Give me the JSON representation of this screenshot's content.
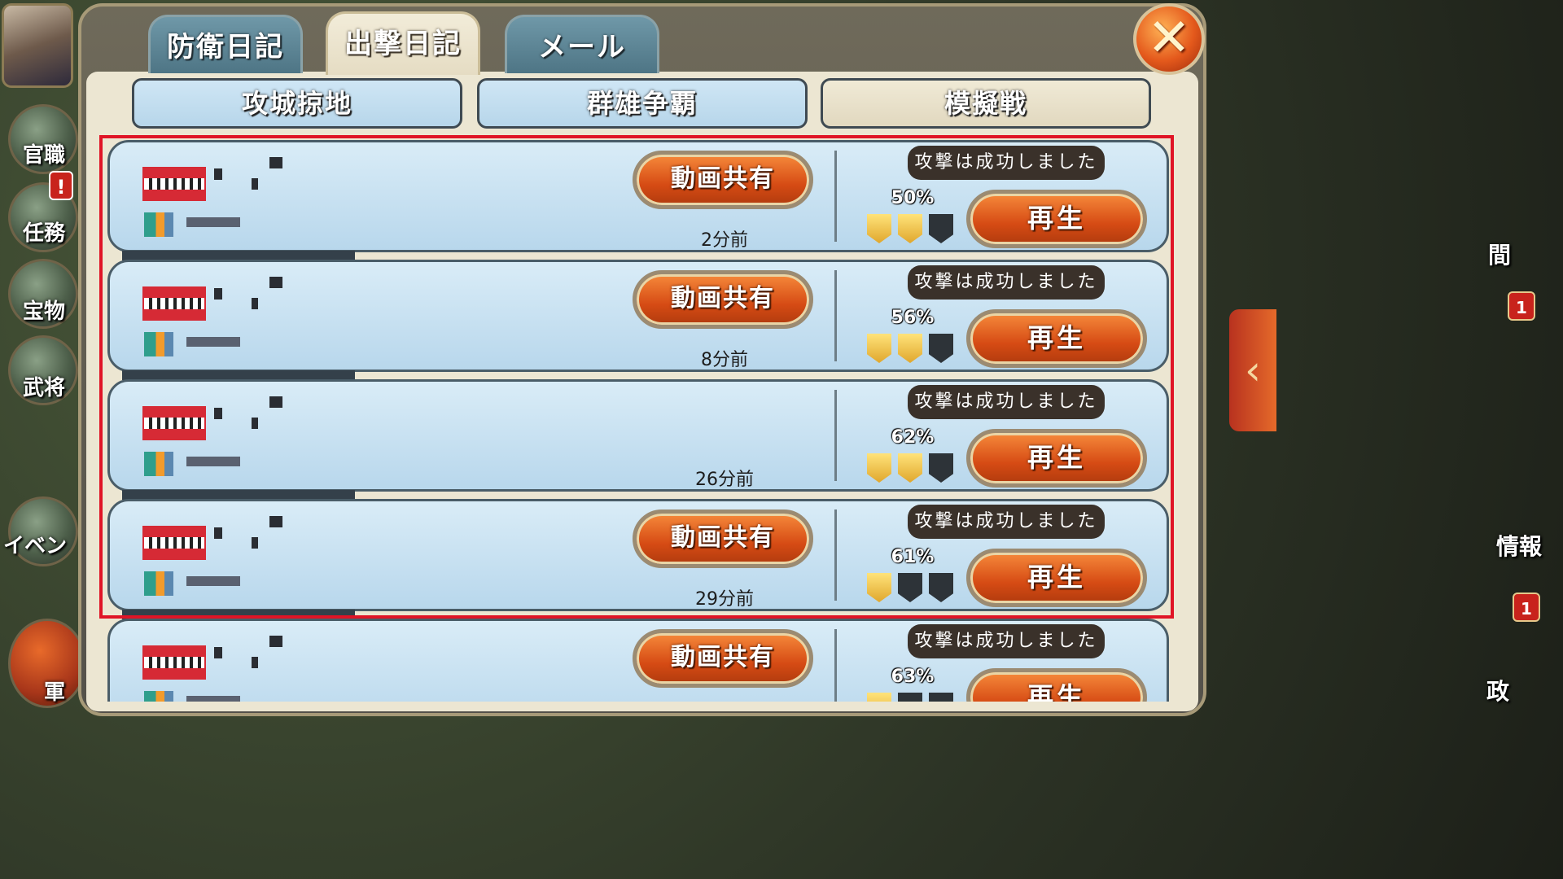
{
  "tabs": {
    "defense": "防衛日記",
    "attack": "出撃日記",
    "mail": "メール"
  },
  "subtabs": {
    "siege": "攻城掠地",
    "heroes": "群雄争覇",
    "mock": "模擬戦"
  },
  "close_icon": "close-x-icon",
  "left_menu": {
    "officials": "官職",
    "tasks": "任務",
    "treasure": "宝物",
    "generals": "武将",
    "event": "イベン",
    "army": "軍"
  },
  "right_menu": {
    "time_frag": "間",
    "intel": "情報",
    "politics": "政",
    "badge_top": "1",
    "badge_bottom": "1"
  },
  "alert_badge": "!",
  "battles": [
    {
      "share_label": "動画共有",
      "time": "2分前",
      "result": "攻撃は成功しました",
      "percent": "50%",
      "play_label": "再生",
      "medals": [
        "gold",
        "gold",
        "dark"
      ],
      "has_share": true
    },
    {
      "share_label": "動画共有",
      "time": "8分前",
      "result": "攻撃は成功しました",
      "percent": "56%",
      "play_label": "再生",
      "medals": [
        "gold",
        "gold",
        "dark"
      ],
      "has_share": true
    },
    {
      "share_label": "",
      "time": "26分前",
      "result": "攻撃は成功しました",
      "percent": "62%",
      "play_label": "再生",
      "medals": [
        "gold",
        "gold",
        "dark"
      ],
      "has_share": false
    },
    {
      "share_label": "動画共有",
      "time": "29分前",
      "result": "攻撃は成功しました",
      "percent": "61%",
      "play_label": "再生",
      "medals": [
        "gold",
        "dark",
        "dark"
      ],
      "has_share": true
    },
    {
      "share_label": "動画共有",
      "time": "",
      "result": "攻撃は成功しました",
      "percent": "63%",
      "play_label": "再生",
      "medals": [
        "gold",
        "dark",
        "dark"
      ],
      "has_share": true
    }
  ],
  "colors": {
    "highlight": "#e01426",
    "row_bg": "#b8d7ec",
    "button_orange": "#d64b14"
  }
}
